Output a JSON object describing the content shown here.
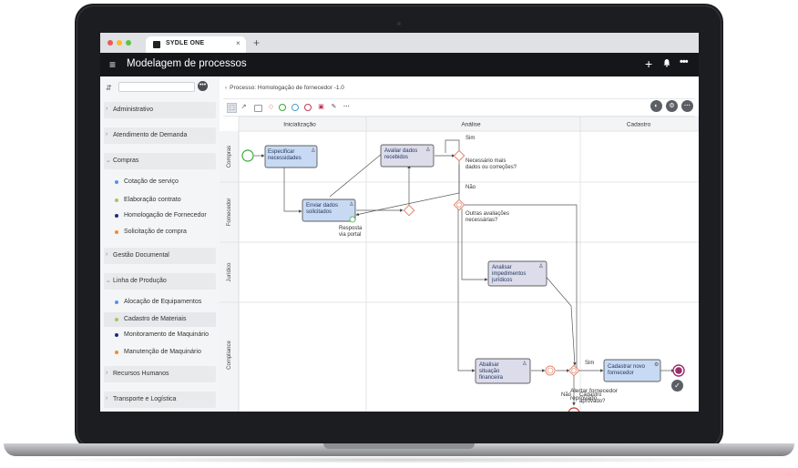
{
  "browser": {
    "tab_title": "SYDLE ONE",
    "tab_close": "×",
    "new_tab": "+"
  },
  "app": {
    "menu_icon": "≡",
    "title": "Modelagem de processos",
    "add_icon": "+",
    "more_icon": "•••"
  },
  "sidebar": {
    "filter_icon": "⇵",
    "more_icon": "•••",
    "groups": [
      {
        "label": "Administrativo",
        "expanded": false
      },
      {
        "label": "Atendimento de Demanda",
        "expanded": false
      },
      {
        "label": "Compras",
        "expanded": true,
        "items": [
          {
            "label": "Cotação de serviço",
            "color": "#5b8def"
          },
          {
            "label": "Elaboração contrato",
            "color": "#a3c75a"
          },
          {
            "label": "Homologação de Fornecedor",
            "color": "#1d2c7a"
          },
          {
            "label": "Solicitação de compra",
            "color": "#f08a3c"
          }
        ]
      },
      {
        "label": "Gestão Documental",
        "expanded": false
      },
      {
        "label": "Linha de Produção",
        "expanded": true,
        "items": [
          {
            "label": "Alocação de Equipamentos",
            "color": "#5b8def"
          },
          {
            "label": "Cadastro de Materiais",
            "color": "#a3c75a"
          },
          {
            "label": "Monitoramento de Maquinário",
            "color": "#1d2c7a"
          },
          {
            "label": "Manutenção de Maquinário",
            "color": "#f08a3c"
          }
        ]
      },
      {
        "label": "Recursos Humanos",
        "expanded": false
      },
      {
        "label": "Transporte e Logística",
        "expanded": false
      }
    ]
  },
  "main": {
    "breadcrumb": "Processo: Homologação de fornecedor -1.0"
  },
  "diagram": {
    "phases": [
      "Inicialização",
      "Análise",
      "Cadastro"
    ],
    "lanes": [
      "Compras",
      "Fornecedor",
      "Jurídico",
      "Compliance"
    ],
    "tasks": {
      "t1": [
        "Especificar",
        "necessidades"
      ],
      "t2": [
        "Enviar dados",
        "solicitados"
      ],
      "t3": [
        "Avaliar dados",
        "recebidos"
      ],
      "t4": [
        "Analisar",
        "impedimentos",
        "jurídicos"
      ],
      "t5": [
        "Abalisar",
        "situação",
        "financeira"
      ],
      "t6": [
        "Cadastrar novo",
        "fornecedor"
      ]
    },
    "labels": {
      "sim1": "Sim",
      "q1a": "Necessário mais",
      "q1b": "dados ou correções?",
      "nao1": "Não",
      "q2a": "Outras avaliações",
      "q2b": "necessárias?",
      "resp_a": "Resposta",
      "resp_b": "via portal",
      "sim2": "Sim",
      "nao2": "Não",
      "q3a": "Cadastro",
      "q3b": "aprovado?",
      "alert_a": "Alertar fornecedor",
      "alert_b": "reprovado"
    },
    "colors": {
      "task_fill": "#c8daf3",
      "task_fill_gray": "#dcdceb",
      "gateway": "#e0846a",
      "start": "#38a838",
      "end": "#9b2d6a"
    }
  }
}
